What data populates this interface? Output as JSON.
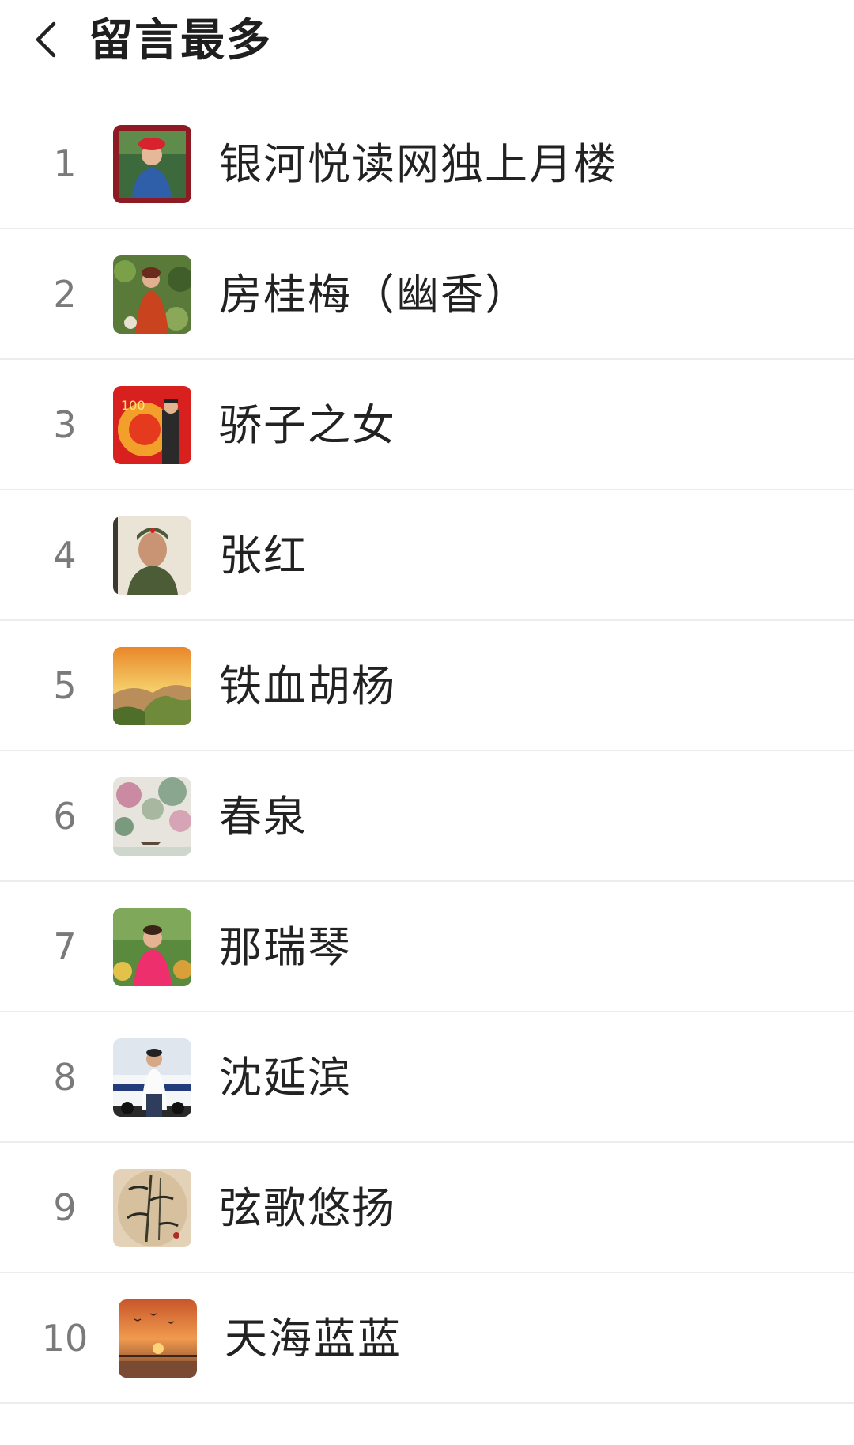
{
  "header": {
    "title": "留言最多",
    "back_icon": "chevron-left-icon"
  },
  "users": [
    {
      "rank": "1",
      "name": "银河悦读网独上月楼"
    },
    {
      "rank": "2",
      "name": "房桂梅（幽香）"
    },
    {
      "rank": "3",
      "name": "骄子之女"
    },
    {
      "rank": "4",
      "name": "张红"
    },
    {
      "rank": "5",
      "name": "铁血胡杨"
    },
    {
      "rank": "6",
      "name": "春泉"
    },
    {
      "rank": "7",
      "name": "那瑞琴"
    },
    {
      "rank": "8",
      "name": "沈延滨"
    },
    {
      "rank": "9",
      "name": "弦歌悠扬"
    },
    {
      "rank": "10",
      "name": "天海蓝蓝"
    }
  ]
}
